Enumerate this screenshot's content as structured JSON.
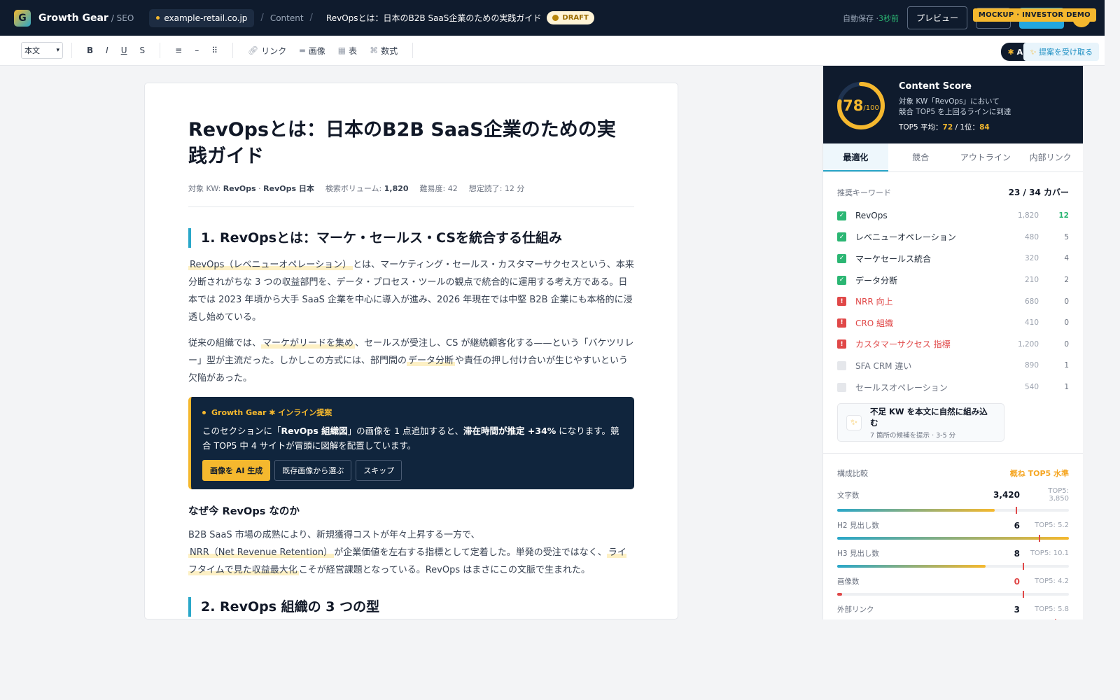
{
  "topbar": {
    "logo_letter": "G",
    "brand": "Growth Gear",
    "brand_sub": "/ SEO",
    "domain": "example-retail.co.jp",
    "breadcrumb_section": "Content",
    "breadcrumb_title": "RevOpsとは：日本のB2B SaaS企業のための実践ガイド",
    "status_badge": "DRAFT",
    "autosave_label": "自動保存 ·",
    "autosave_time": "3秒前",
    "preview_label": "プレビュー",
    "mock_badge": "MOCKUP · INVESTOR DEMO"
  },
  "toolbar": {
    "block_type": "本文",
    "bold": "B",
    "italic": "I",
    "underline": "U",
    "strike": "S",
    "list": "≡",
    "divider": "–",
    "drag": "⠿",
    "link": "リンク",
    "image": "画像",
    "table": "表",
    "formula": "数式",
    "ai_status": "AI 並走中",
    "suggest": "提案を受け取る"
  },
  "doc": {
    "title": "RevOpsとは：日本のB2B SaaS企業のための実践ガイド",
    "meta": {
      "kw_label": "対象 KW:",
      "kw1": "RevOps",
      "kw_sep": "·",
      "kw2": "RevOps 日本",
      "volume_label": "検索ボリューム:",
      "volume": "1,820",
      "difficulty": "難易度: 42",
      "read_time": "想定読了: 12 分"
    },
    "h2_1": "1. RevOpsとは：マーケ・セールス・CSを統合する仕組み",
    "p1_hl": "RevOps（レベニューオペレーション）",
    "p1_rest": "とは、マーケティング・セールス・カスタマーサクセスという、本来分断されがちな 3 つの収益部門を、データ・プロセス・ツールの観点で統合的に運用する考え方である。日本では 2023 年頃から大手 SaaS 企業を中心に導入が進み、2026 年現在では中堅 B2B 企業にも本格的に浸透し始めている。",
    "p2_a": "従来の組織では、",
    "p2_hl1": "マーケがリードを集め",
    "p2_b": "、セールスが受注し、CS が継続顧客化する——という「バケツリレー」型が主流だった。しかしこの方式には、部門間の",
    "p2_hl2": "データ分断",
    "p2_c": "や責任の押し付け合いが生じやすいという欠陥があった。",
    "callout": {
      "label": "Growth Gear ✱ インライン提案",
      "text_a": "このセクションに「",
      "text_b": "RevOps 組織図",
      "text_c": "」の画像を 1 点追加すると、",
      "text_d": "滞在時間が推定 +34%",
      "text_e": " になります。競合 TOP5 中 4 サイトが冒頭に図解を配置しています。",
      "btn_generate": "画像を AI 生成",
      "btn_existing": "既存画像から選ぶ",
      "btn_skip": "スキップ"
    },
    "h3_1": "なぜ今 RevOps なのか",
    "p3_a": "B2B SaaS 市場の成熟により、新規獲得コストが年々上昇する一方で、",
    "p3_hl1": "NRR（Net Revenue Retention）",
    "p3_b": "が企業価値を左右する指標として定着した。単発の受注ではなく、",
    "p3_hl2": "ライフタイムで見た収益最大化",
    "p3_c": "こそが経営課題となっている。RevOps はまさにこの文脈で生まれた。",
    "h2_2": "2. RevOps 組織の 3 つの型"
  },
  "sidebar": {
    "score": {
      "value": "78",
      "max": "/100",
      "fraction": 0.78,
      "title": "Content Score",
      "desc1": "対象 KW「RevOps」において",
      "desc2": "競合 TOP5 を上回るラインに到達",
      "avg_label": "TOP5 平均：",
      "avg": "72",
      "first_label": " / 1位：",
      "first": "84"
    },
    "tabs": [
      "最適化",
      "競合",
      "アウトライン",
      "内部リンク"
    ],
    "keywords_title": "推奨キーワード",
    "keywords_cover": "23 / 34 カバー",
    "keywords": [
      {
        "name": "RevOps",
        "vol": "1,820",
        "count": "12",
        "status": "ok",
        "mark": "✓"
      },
      {
        "name": "レベニューオペレーション",
        "vol": "480",
        "count": "5",
        "status": "ok",
        "mark": "✓"
      },
      {
        "name": "マーケセールス統合",
        "vol": "320",
        "count": "4",
        "status": "ok",
        "mark": "✓"
      },
      {
        "name": "データ分断",
        "vol": "210",
        "count": "2",
        "status": "ok",
        "mark": "✓"
      },
      {
        "name": "NRR 向上",
        "vol": "680",
        "count": "0",
        "status": "warn",
        "mark": "!"
      },
      {
        "name": "CRO 組織",
        "vol": "410",
        "count": "0",
        "status": "warn",
        "mark": "!"
      },
      {
        "name": "カスタマーサクセス 指標",
        "vol": "1,200",
        "count": "0",
        "status": "warn",
        "mark": "!"
      },
      {
        "name": "SFA CRM 違い",
        "vol": "890",
        "count": "1",
        "status": "none",
        "mark": ""
      },
      {
        "name": "セールスオペレーション",
        "vol": "540",
        "count": "1",
        "status": "none",
        "mark": ""
      }
    ],
    "insert_title": "不足 KW を本文に自然に組み込む",
    "insert_sub": "7 箇所の候補を提示 · 3-5 分",
    "compare_title": "構成比較",
    "compare_status": "概ね TOP5 水準",
    "compare": [
      {
        "label": "文字数",
        "value": "3,420",
        "top5": "TOP5: 3,850",
        "fill": 0.68,
        "mark": 0.77
      },
      {
        "label": "H2 見出し数",
        "value": "6",
        "top5": "TOP5: 5.2",
        "fill": 1.0,
        "mark": 0.87
      },
      {
        "label": "H3 見出し数",
        "value": "8",
        "top5": "TOP5: 10.1",
        "fill": 0.64,
        "mark": 0.8
      },
      {
        "label": "画像数",
        "value": "0",
        "top5": "TOP5: 4.2",
        "fill": 0.02,
        "mark": 0.8
      },
      {
        "label": "外部リンク",
        "value": "3",
        "top5": "TOP5: 5.8",
        "fill": 0.48,
        "mark": 0.94
      }
    ]
  },
  "colors": {
    "navy": "#0f1b2d",
    "accent_yellow": "#f5b82e",
    "accent_blue": "#2aa7c9",
    "ok_green": "#2bb673",
    "warn_red": "#e04848"
  }
}
